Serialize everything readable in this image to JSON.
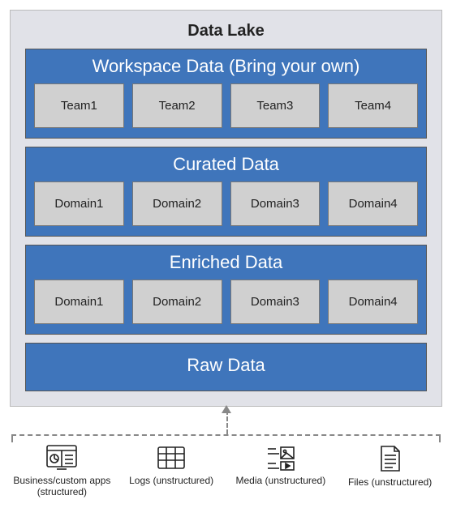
{
  "diagram": {
    "title": "Data Lake",
    "layers": [
      {
        "title": "Workspace Data (Bring your own)",
        "items": [
          "Team1",
          "Team2",
          "Team3",
          "Team4"
        ]
      },
      {
        "title": "Curated Data",
        "items": [
          "Domain1",
          "Domain2",
          "Domain3",
          "Domain4"
        ]
      },
      {
        "title": "Enriched Data",
        "items": [
          "Domain1",
          "Domain2",
          "Domain3",
          "Domain4"
        ]
      },
      {
        "title": "Raw Data",
        "items": []
      }
    ],
    "sources": [
      {
        "icon": "app-icon",
        "label_line1": "Business/custom apps",
        "label_line2": "(structured)"
      },
      {
        "icon": "logs-icon",
        "label_line1": "Logs (unstructured)",
        "label_line2": ""
      },
      {
        "icon": "media-icon",
        "label_line1": "Media (unstructured)",
        "label_line2": ""
      },
      {
        "icon": "files-icon",
        "label_line1": "Files (unstructured)",
        "label_line2": ""
      }
    ]
  }
}
